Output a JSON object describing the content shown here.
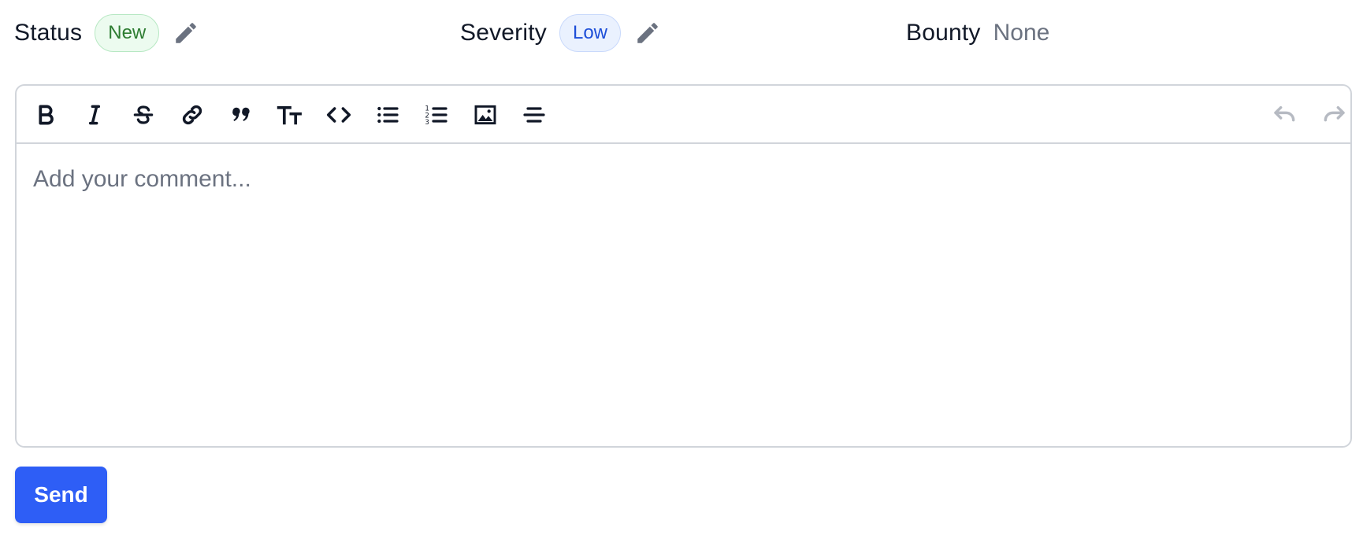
{
  "meta": {
    "status": {
      "label": "Status",
      "value": "New"
    },
    "severity": {
      "label": "Severity",
      "value": "Low"
    },
    "bounty": {
      "label": "Bounty",
      "value": "None"
    }
  },
  "editor": {
    "placeholder": "Add your comment...",
    "toolbar": [
      {
        "name": "bold",
        "icon": "bold-icon"
      },
      {
        "name": "italic",
        "icon": "italic-icon"
      },
      {
        "name": "strikethrough",
        "icon": "strikethrough-icon"
      },
      {
        "name": "link",
        "icon": "link-icon"
      },
      {
        "name": "quote",
        "icon": "quote-icon"
      },
      {
        "name": "text-size",
        "icon": "text-size-icon"
      },
      {
        "name": "code",
        "icon": "code-icon"
      },
      {
        "name": "bullet-list",
        "icon": "bullet-list-icon"
      },
      {
        "name": "numbered-list",
        "icon": "numbered-list-icon"
      },
      {
        "name": "image",
        "icon": "image-icon"
      },
      {
        "name": "horizontal-rule",
        "icon": "horizontal-rule-icon"
      }
    ],
    "history": [
      {
        "name": "undo",
        "icon": "undo-icon",
        "enabled": false
      },
      {
        "name": "redo",
        "icon": "redo-icon",
        "enabled": false
      }
    ]
  },
  "actions": {
    "send_label": "Send"
  },
  "colors": {
    "status_badge_bg": "#ecfbef",
    "status_badge_text": "#2e7d32",
    "severity_badge_bg": "#eaf1fe",
    "severity_badge_text": "#1d4ed8",
    "send_button": "#2e5ef6",
    "edit_icon": "#6b7280"
  }
}
